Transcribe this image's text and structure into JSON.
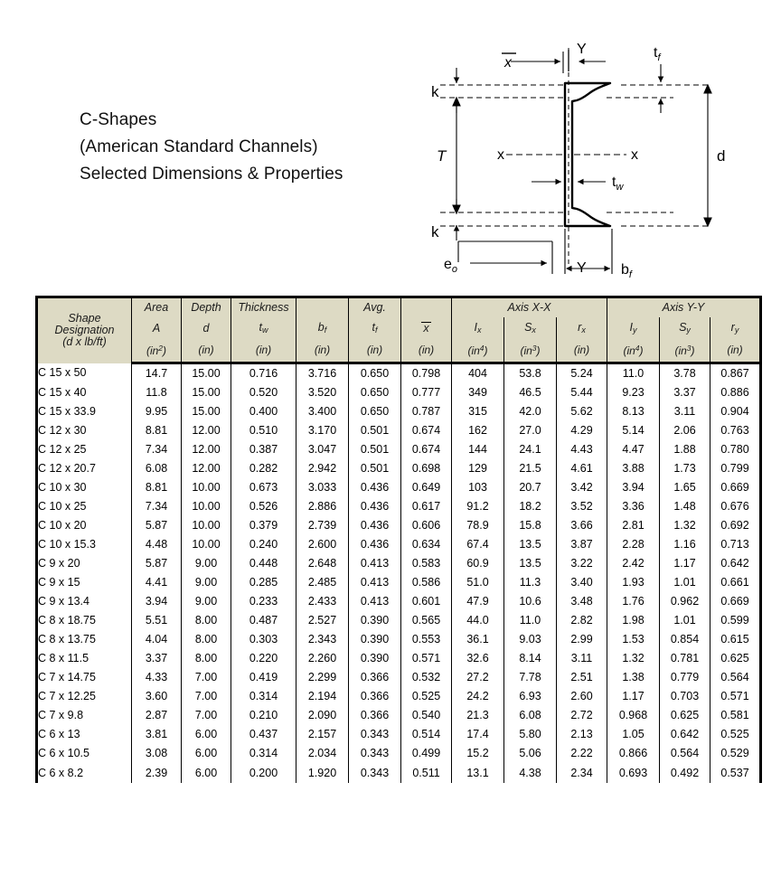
{
  "title": {
    "line1": "C-Shapes",
    "line2": "(American Standard Channels)",
    "line3": "Selected Dimensions & Properties"
  },
  "diagram": {
    "name": "channel-cross-section",
    "labels": {
      "y_top": "Y",
      "y_bottom": "Y",
      "x_bar": "x",
      "t_f": "t",
      "t_f_sub": "f",
      "t_w": "t",
      "t_w_sub": "w",
      "k_top": "k",
      "k_bottom": "k",
      "T": "T",
      "d": "d",
      "x_left": "x",
      "x_right": "x",
      "e_o": "e",
      "e_o_sub": "o",
      "b_f": "b",
      "b_f_sub": "f"
    }
  },
  "table": {
    "group_headers": {
      "axis_x": "Axis X-X",
      "axis_y": "Axis Y-Y"
    },
    "columns": [
      {
        "name": "Shape",
        "line2": "Designation",
        "line3": "(d x lb/ft)",
        "symbol": "",
        "sub": "",
        "unit": ""
      },
      {
        "name": "Area",
        "symbol": "A",
        "sub": "",
        "unit": "(in",
        "unit_sup": "2",
        "unit_end": ")"
      },
      {
        "name": "Depth",
        "symbol": "d",
        "sub": "",
        "unit": "(in)"
      },
      {
        "name": "Thickness",
        "symbol": "t",
        "sub": "w",
        "unit": "(in)"
      },
      {
        "name": "",
        "symbol": "b",
        "sub": "f",
        "unit": "(in)"
      },
      {
        "name": "Avg.",
        "symbol": "t",
        "sub": "f",
        "unit": "(in)"
      },
      {
        "name": "",
        "symbol": "x",
        "sub": "",
        "unit": "(in)"
      },
      {
        "name": "",
        "symbol": "I",
        "sub": "x",
        "unit": "(in",
        "unit_sup": "4",
        "unit_end": ")"
      },
      {
        "name": "",
        "symbol": "S",
        "sub": "x",
        "unit": "(in",
        "unit_sup": "3",
        "unit_end": ")"
      },
      {
        "name": "",
        "symbol": "r",
        "sub": "x",
        "unit": "(in)"
      },
      {
        "name": "",
        "symbol": "I",
        "sub": "y",
        "unit": "(in",
        "unit_sup": "4",
        "unit_end": ")"
      },
      {
        "name": "",
        "symbol": "S",
        "sub": "y",
        "unit": "(in",
        "unit_sup": "3",
        "unit_end": ")"
      },
      {
        "name": "",
        "symbol": "r",
        "sub": "y",
        "unit": "(in)"
      }
    ],
    "rows": [
      [
        "C 15 x 50",
        "14.7",
        "15.00",
        "0.716",
        "3.716",
        "0.650",
        "0.798",
        "404",
        "53.8",
        "5.24",
        "11.0",
        "3.78",
        "0.867"
      ],
      [
        "C 15 x 40",
        "11.8",
        "15.00",
        "0.520",
        "3.520",
        "0.650",
        "0.777",
        "349",
        "46.5",
        "5.44",
        "9.23",
        "3.37",
        "0.886"
      ],
      [
        "C 15 x 33.9",
        "9.95",
        "15.00",
        "0.400",
        "3.400",
        "0.650",
        "0.787",
        "315",
        "42.0",
        "5.62",
        "8.13",
        "3.11",
        "0.904"
      ],
      [
        "C 12 x 30",
        "8.81",
        "12.00",
        "0.510",
        "3.170",
        "0.501",
        "0.674",
        "162",
        "27.0",
        "4.29",
        "5.14",
        "2.06",
        "0.763"
      ],
      [
        "C 12 x 25",
        "7.34",
        "12.00",
        "0.387",
        "3.047",
        "0.501",
        "0.674",
        "144",
        "24.1",
        "4.43",
        "4.47",
        "1.88",
        "0.780"
      ],
      [
        "C 12 x 20.7",
        "6.08",
        "12.00",
        "0.282",
        "2.942",
        "0.501",
        "0.698",
        "129",
        "21.5",
        "4.61",
        "3.88",
        "1.73",
        "0.799"
      ],
      [
        "C 10 x 30",
        "8.81",
        "10.00",
        "0.673",
        "3.033",
        "0.436",
        "0.649",
        "103",
        "20.7",
        "3.42",
        "3.94",
        "1.65",
        "0.669"
      ],
      [
        "C 10 x 25",
        "7.34",
        "10.00",
        "0.526",
        "2.886",
        "0.436",
        "0.617",
        "91.2",
        "18.2",
        "3.52",
        "3.36",
        "1.48",
        "0.676"
      ],
      [
        "C 10 x 20",
        "5.87",
        "10.00",
        "0.379",
        "2.739",
        "0.436",
        "0.606",
        "78.9",
        "15.8",
        "3.66",
        "2.81",
        "1.32",
        "0.692"
      ],
      [
        "C 10 x 15.3",
        "4.48",
        "10.00",
        "0.240",
        "2.600",
        "0.436",
        "0.634",
        "67.4",
        "13.5",
        "3.87",
        "2.28",
        "1.16",
        "0.713"
      ],
      [
        "C 9 x 20",
        "5.87",
        "9.00",
        "0.448",
        "2.648",
        "0.413",
        "0.583",
        "60.9",
        "13.5",
        "3.22",
        "2.42",
        "1.17",
        "0.642"
      ],
      [
        "C 9 x 15",
        "4.41",
        "9.00",
        "0.285",
        "2.485",
        "0.413",
        "0.586",
        "51.0",
        "11.3",
        "3.40",
        "1.93",
        "1.01",
        "0.661"
      ],
      [
        "C 9 x 13.4",
        "3.94",
        "9.00",
        "0.233",
        "2.433",
        "0.413",
        "0.601",
        "47.9",
        "10.6",
        "3.48",
        "1.76",
        "0.962",
        "0.669"
      ],
      [
        "C 8 x 18.75",
        "5.51",
        "8.00",
        "0.487",
        "2.527",
        "0.390",
        "0.565",
        "44.0",
        "11.0",
        "2.82",
        "1.98",
        "1.01",
        "0.599"
      ],
      [
        "C 8 x 13.75",
        "4.04",
        "8.00",
        "0.303",
        "2.343",
        "0.390",
        "0.553",
        "36.1",
        "9.03",
        "2.99",
        "1.53",
        "0.854",
        "0.615"
      ],
      [
        "C 8 x 11.5",
        "3.37",
        "8.00",
        "0.220",
        "2.260",
        "0.390",
        "0.571",
        "32.6",
        "8.14",
        "3.11",
        "1.32",
        "0.781",
        "0.625"
      ],
      [
        "C 7 x 14.75",
        "4.33",
        "7.00",
        "0.419",
        "2.299",
        "0.366",
        "0.532",
        "27.2",
        "7.78",
        "2.51",
        "1.38",
        "0.779",
        "0.564"
      ],
      [
        "C 7 x 12.25",
        "3.60",
        "7.00",
        "0.314",
        "2.194",
        "0.366",
        "0.525",
        "24.2",
        "6.93",
        "2.60",
        "1.17",
        "0.703",
        "0.571"
      ],
      [
        "C 7 x 9.8",
        "2.87",
        "7.00",
        "0.210",
        "2.090",
        "0.366",
        "0.540",
        "21.3",
        "6.08",
        "2.72",
        "0.968",
        "0.625",
        "0.581"
      ],
      [
        "C 6 x 13",
        "3.81",
        "6.00",
        "0.437",
        "2.157",
        "0.343",
        "0.514",
        "17.4",
        "5.80",
        "2.13",
        "1.05",
        "0.642",
        "0.525"
      ],
      [
        "C 6 x 10.5",
        "3.08",
        "6.00",
        "0.314",
        "2.034",
        "0.343",
        "0.499",
        "15.2",
        "5.06",
        "2.22",
        "0.866",
        "0.564",
        "0.529"
      ],
      [
        "C 6 x 8.2",
        "2.39",
        "6.00",
        "0.200",
        "1.920",
        "0.343",
        "0.511",
        "13.1",
        "4.38",
        "2.34",
        "0.693",
        "0.492",
        "0.537"
      ]
    ]
  },
  "colors": {
    "header_bg": "#dddac4",
    "border": "#000000",
    "text": "#000000",
    "page_bg": "#ffffff"
  }
}
